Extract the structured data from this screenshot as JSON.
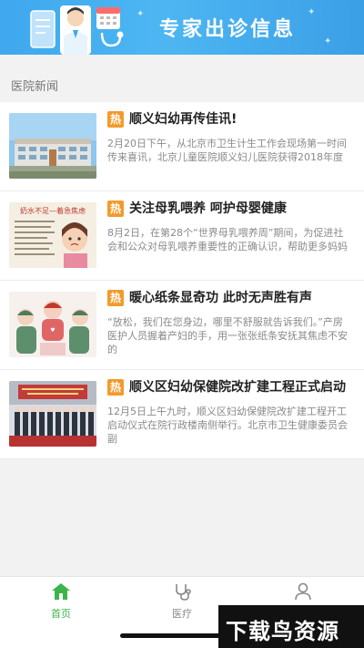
{
  "banner": {
    "title": "专家出诊信息"
  },
  "section": {
    "title": "医院新闻"
  },
  "news": [
    {
      "badge": "热",
      "title": "顺义妇幼再传佳讯!",
      "summary": "2月20日下午，从北京市卫生计生工作会现场第一时间传来喜讯，北京儿童医院顺义妇儿医院获得2018年度",
      "thumb": "hospital-building-photo"
    },
    {
      "badge": "热",
      "title": "关注母乳喂养 呵护母婴健康",
      "summary": "8月2日，在第28个“世界母乳喂养周”期间，为促进社会和公众对母乳喂养重要性的正确认识，帮助更多妈妈",
      "thumb_caption": "奶水不足—着急焦虑",
      "thumb": "breastfeeding-poster"
    },
    {
      "badge": "热",
      "title": "暖心纸条显奇功 此时无声胜有声",
      "summary": "“放松，我们在您身边，哪里不舒服就告诉我们。”产房医护人员握着产妇的手，用一张张纸条安抚其焦虑不安的",
      "thumb": "delivery-room-illustration"
    },
    {
      "badge": "热",
      "title": "顺义区妇幼保健院改扩建工程正式启动",
      "summary": "12月5日上午九时，顺义区妇幼保健院改扩建工程开工启动仪式在院行政楼南侧举行。北京市卫生健康委员会副",
      "thumb": "groundbreaking-ceremony-photo"
    }
  ],
  "tabs": [
    {
      "label": "首页",
      "icon": "home-icon",
      "active": true
    },
    {
      "label": "医疗",
      "icon": "stethoscope-icon",
      "active": false
    },
    {
      "label": "我的",
      "icon": "user-icon",
      "active": false
    }
  ],
  "watermark": {
    "text": "下载鸟资源"
  },
  "colors": {
    "banner": "#3fa8ee",
    "hot_badge": "#f39a2c",
    "active_tab": "#3bb54a"
  }
}
